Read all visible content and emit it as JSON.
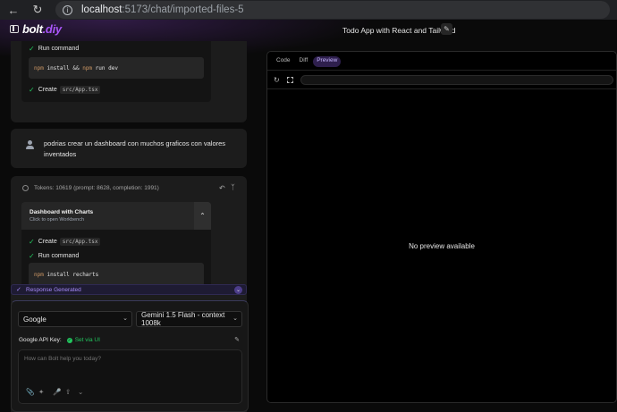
{
  "browser": {
    "url_host": "localhost",
    "url_path": ":5173/chat/imported-files-5"
  },
  "header": {
    "logo_main": "bolt",
    "logo_accent": ".diy",
    "chat_title": "Todo App with React and Tailwind"
  },
  "first_message": {
    "steps": [
      {
        "label": "Run command"
      },
      {
        "label": "Create",
        "code": "src/App.tsx"
      }
    ],
    "command_kw1": "npm",
    "command_mid": " install && ",
    "command_kw2": "npm",
    "command_rest": " run dev"
  },
  "user_message": {
    "text": "podrias crear un dashboard con muchos graficos con valores inventados"
  },
  "assistant_message": {
    "tokens": "Tokens: 10619 (prompt: 8628, completion: 1991)",
    "artifact_title": "Dashboard with Charts",
    "artifact_subtitle": "Click to open Workbench",
    "steps": [
      {
        "label": "Create",
        "code": "src/App.tsx"
      },
      {
        "label": "Run command"
      }
    ],
    "command_kw": "npm",
    "command_rest": " install recharts"
  },
  "response_status": "Response Generated",
  "input": {
    "provider": "Google",
    "model": "Gemini 1.5 Flash - context 1008k",
    "api_key_label": "Google API Key:",
    "api_key_status": "Set via UI",
    "placeholder": "How can Bolt help you today?"
  },
  "preview": {
    "tabs": [
      "Code",
      "Diff",
      "Preview"
    ],
    "active_tab": "Preview",
    "empty_message": "No preview available"
  }
}
